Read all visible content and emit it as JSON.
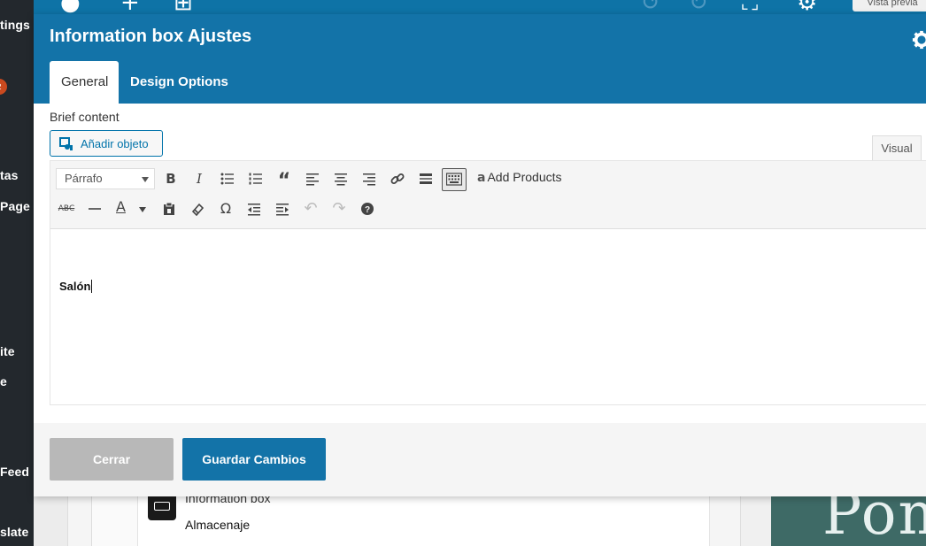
{
  "sidebar": {
    "items": [
      "tings",
      "tas",
      "Page",
      "ite",
      "e",
      "Feed",
      "slate"
    ],
    "badge": "2"
  },
  "topbar": {
    "preview_label": "Vista previa"
  },
  "modal": {
    "title": "Information box Ajustes",
    "tabs": [
      {
        "label": "General",
        "active": true
      },
      {
        "label": "Design Options",
        "active": false
      }
    ],
    "field_label": "Brief content",
    "add_object_label": "Añadir objeto",
    "visual_tab": "Visual",
    "format_select": "Párrafo",
    "add_products_label": "Add Products",
    "content_text": "Salón",
    "close_label": "Cerrar",
    "save_label": "Guardar Cambios"
  },
  "background": {
    "element_name": "Information box",
    "element_title": "Almacenaje",
    "image_text": "Pom"
  },
  "colors": {
    "header_blue": "#1373a8",
    "admin_dark": "#23282d",
    "close_gray": "#b8b8b8"
  },
  "icons": {
    "toolbar_row1": [
      "bold-icon",
      "italic-icon",
      "bulleted-list-icon",
      "numbered-list-icon",
      "blockquote-icon",
      "align-left-icon",
      "align-center-icon",
      "align-right-icon",
      "link-icon",
      "read-more-icon",
      "toolbar-toggle-icon",
      "amazon-icon"
    ],
    "toolbar_row2": [
      "strikethrough-icon",
      "horizontal-line-icon",
      "text-color-icon",
      "paste-text-icon",
      "clear-formatting-icon",
      "special-character-icon",
      "outdent-icon",
      "indent-icon",
      "undo-icon",
      "redo-icon",
      "help-icon"
    ]
  }
}
